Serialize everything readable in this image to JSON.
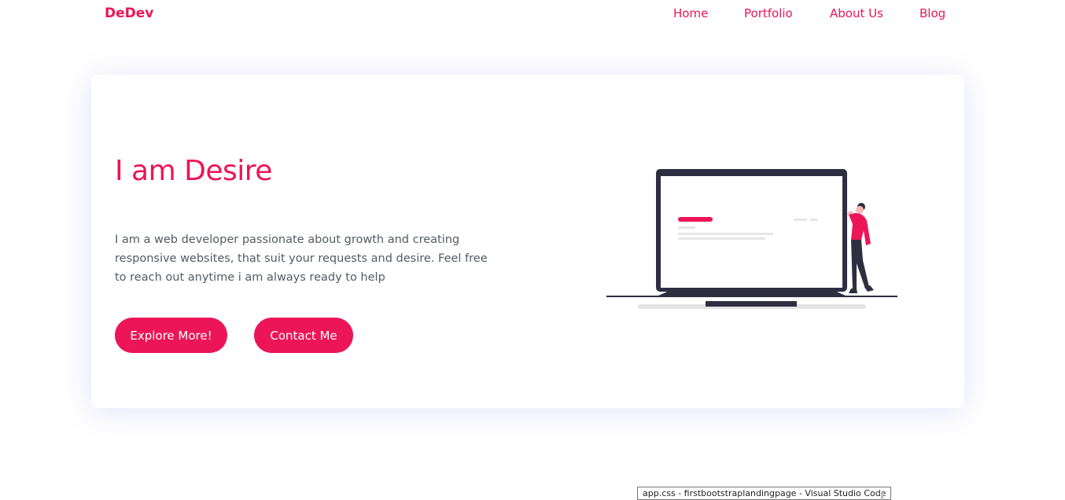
{
  "brand": "DeDev",
  "nav": {
    "items": [
      {
        "label": "Home"
      },
      {
        "label": "Portfolio"
      },
      {
        "label": "About Us"
      },
      {
        "label": "Blog"
      }
    ]
  },
  "hero": {
    "title": "I am Desire",
    "description": "I am a web developer passionate about growth and creating responsive websites, that suit your requests and desire. Feel free to reach out anytime i am always ready to help",
    "explore_label": "Explore More!",
    "contact_label": "Contact Me"
  },
  "illustration": {
    "icon": "laptop-woman-illustration",
    "accent_color": "#ec1558",
    "dark_color": "#2f2e41"
  },
  "tooltip": {
    "text": "app.css - firstbootstraplandingpage - Visual Studio Code"
  },
  "colors": {
    "accent": "#ec1558",
    "body_text": "#555a66",
    "background": "#ffffff"
  }
}
